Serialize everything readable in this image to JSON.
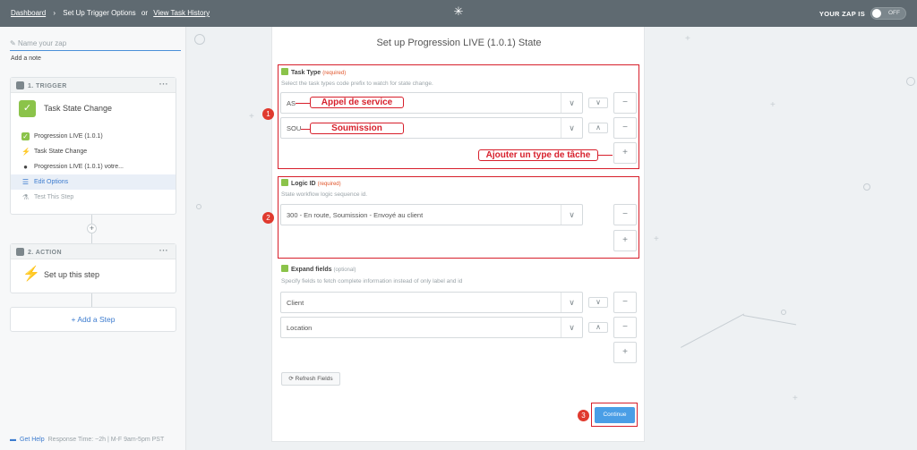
{
  "topbar": {
    "dashboard": "Dashboard",
    "crumb": "Set Up Trigger Options",
    "or": "or",
    "history": "View Task History",
    "zap_is": "YOUR ZAP IS",
    "toggle": "OFF"
  },
  "sidebar": {
    "zap_name_placeholder": "Name your zap",
    "add_note": "Add a note",
    "trigger": {
      "head": "1. TRIGGER",
      "title": "Task State Change",
      "items": [
        {
          "label": "Progression LIVE (1.0.1)",
          "icon": "app-icon"
        },
        {
          "label": "Task State Change",
          "icon": "bolt-icon"
        },
        {
          "label": "Progression LIVE (1.0.1) votre...",
          "icon": "user-icon"
        },
        {
          "label": "Edit Options",
          "icon": "list-icon"
        },
        {
          "label": "Test This Step",
          "icon": "flask-icon"
        }
      ]
    },
    "action": {
      "head": "2. ACTION",
      "title": "Set up this step"
    },
    "add_step": "+ Add a Step",
    "help": {
      "link": "Get Help",
      "text": "Response Time: ~2h | M-F 9am-5pm PST"
    }
  },
  "main": {
    "title": "Set up Progression LIVE (1.0.1) State",
    "task_type": {
      "label": "Task Type",
      "req": "(required)",
      "desc": "Select the task types code prefix to watch for state change.",
      "values": [
        "AS",
        "SOU"
      ]
    },
    "logic_id": {
      "label": "Logic ID",
      "req": "(required)",
      "desc": "State workflow logic sequence id.",
      "value": "300 - En route, Soumission - Envoyé au client"
    },
    "expand": {
      "label": "Expand fields",
      "opt": "(optional)",
      "desc": "Specify fields to fetch complete information instead of only label and id",
      "values": [
        "Client",
        "Location"
      ]
    },
    "refresh": "Refresh Fields",
    "continue": "Continue"
  },
  "annotations": {
    "badges": [
      "1",
      "2",
      "3"
    ],
    "appel": "Appel de service",
    "soumission": "Soumission",
    "ajouter": "Ajouter un type de tâche"
  },
  "colors": {
    "topbar": "#5f6a71",
    "accent": "#4a9ee6",
    "annotation": "#d71f2b",
    "app_green": "#8bc34a"
  }
}
